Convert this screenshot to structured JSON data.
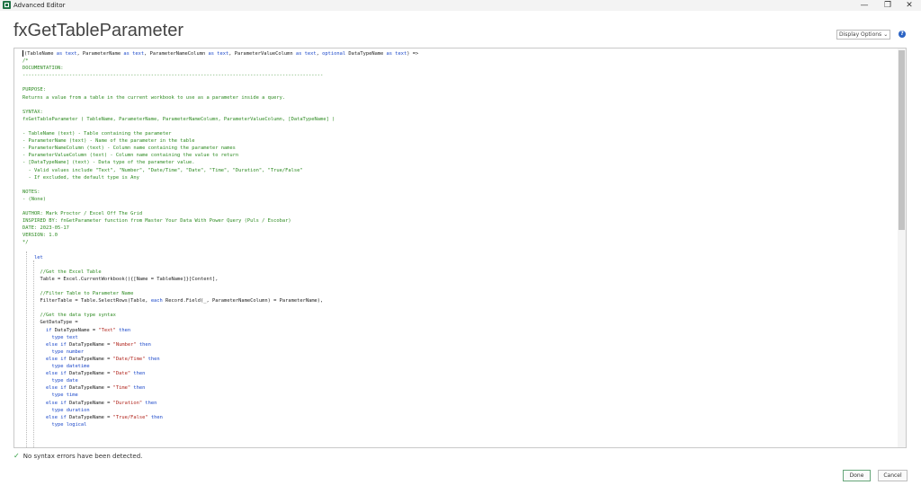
{
  "window": {
    "title": "Advanced Editor",
    "controls": {
      "minimize": "—",
      "maximize": "❐",
      "close": "✕"
    }
  },
  "page_title": "fxGetTableParameter",
  "display_options": {
    "label": "Display Options",
    "chevron": "⌄"
  },
  "help": {
    "glyph": "?"
  },
  "code_lines": [
    [
      {
        "t": "(TableName "
      },
      {
        "t": "as",
        "c": "kw"
      },
      {
        "t": " "
      },
      {
        "t": "text",
        "c": "kw"
      },
      {
        "t": ", ParameterName "
      },
      {
        "t": "as",
        "c": "kw"
      },
      {
        "t": " "
      },
      {
        "t": "text",
        "c": "kw"
      },
      {
        "t": ", ParameterNameColumn "
      },
      {
        "t": "as",
        "c": "kw"
      },
      {
        "t": " "
      },
      {
        "t": "text",
        "c": "kw"
      },
      {
        "t": ", ParameterValueColumn "
      },
      {
        "t": "as",
        "c": "kw"
      },
      {
        "t": " "
      },
      {
        "t": "text",
        "c": "kw"
      },
      {
        "t": ", "
      },
      {
        "t": "optional",
        "c": "kw"
      },
      {
        "t": " DataTypeName "
      },
      {
        "t": "as",
        "c": "kw"
      },
      {
        "t": " "
      },
      {
        "t": "text",
        "c": "kw"
      },
      {
        "t": ") =>"
      }
    ],
    [
      {
        "t": "/*",
        "c": "cm"
      }
    ],
    [
      {
        "t": "DOCUMENTATION:",
        "c": "cm"
      }
    ],
    [
      {
        "t": "-------------------------------------------------------------------------------------------------------",
        "c": "cm"
      }
    ],
    [
      {
        "t": ""
      }
    ],
    [
      {
        "t": "PURPOSE:",
        "c": "cm"
      }
    ],
    [
      {
        "t": "Returns a value from a table in the current workbook to use as a parameter inside a query.",
        "c": "cm"
      }
    ],
    [
      {
        "t": ""
      }
    ],
    [
      {
        "t": "SYNTAX:",
        "c": "cm"
      }
    ],
    [
      {
        "t": "fxGetTableParameter ( TableName, ParameterName, ParameterNameColumn, ParameterValueColumn, [DataTypeName] )",
        "c": "cm"
      }
    ],
    [
      {
        "t": ""
      }
    ],
    [
      {
        "t": "- TableName (text) - Table containing the parameter",
        "c": "cm"
      }
    ],
    [
      {
        "t": "- ParameterName (text) - Name of the parameter in the table",
        "c": "cm"
      }
    ],
    [
      {
        "t": "- ParameterNameColumn (text) - Column name containing the parameter names",
        "c": "cm"
      }
    ],
    [
      {
        "t": "- ParameterValueColumn (text) - Column name containing the value to return",
        "c": "cm"
      }
    ],
    [
      {
        "t": "- [DataTypeName] (text) - Data type of the parameter value.",
        "c": "cm"
      }
    ],
    [
      {
        "t": "  - Valid values include \"Text\", \"Number\", \"Date/Time\", \"Date\", \"Time\", \"Duration\", \"True/False\"",
        "c": "cm"
      }
    ],
    [
      {
        "t": "  - If excluded, the default type is Any",
        "c": "cm"
      }
    ],
    [
      {
        "t": ""
      }
    ],
    [
      {
        "t": "NOTES:",
        "c": "cm"
      }
    ],
    [
      {
        "t": "- (None)",
        "c": "cm"
      }
    ],
    [
      {
        "t": ""
      }
    ],
    [
      {
        "t": "AUTHOR: Mark Proctor / Excel Off The Grid",
        "c": "cm"
      }
    ],
    [
      {
        "t": "INSPIRED BY: fnGetParameter function from Master Your Data With Power Query (Puls / Escobar)",
        "c": "cm"
      }
    ],
    [
      {
        "t": "DATE: 2023-05-17",
        "c": "cm"
      }
    ],
    [
      {
        "t": "VERSION: 1.0",
        "c": "cm"
      }
    ],
    [
      {
        "t": "*/",
        "c": "cm"
      }
    ],
    [
      {
        "t": ""
      }
    ],
    [
      {
        "t": "    "
      },
      {
        "t": "let",
        "c": "kw"
      }
    ],
    [
      {
        "t": ""
      }
    ],
    [
      {
        "t": "      "
      },
      {
        "t": "//Get the Excel Table",
        "c": "cm"
      }
    ],
    [
      {
        "t": "      Table = Excel.CurrentWorkbook(){[Name = TableName]}[Content],"
      }
    ],
    [
      {
        "t": ""
      }
    ],
    [
      {
        "t": "      "
      },
      {
        "t": "//Filter Table to Parameter Name",
        "c": "cm"
      }
    ],
    [
      {
        "t": "      FilterTable = Table.SelectRows(Table, "
      },
      {
        "t": "each",
        "c": "kw"
      },
      {
        "t": " Record.Field(_, ParameterNameColumn) = ParameterName),"
      }
    ],
    [
      {
        "t": ""
      }
    ],
    [
      {
        "t": "      "
      },
      {
        "t": "//Get the data type syntax",
        "c": "cm"
      }
    ],
    [
      {
        "t": "      GetDataType ="
      }
    ],
    [
      {
        "t": "        "
      },
      {
        "t": "if",
        "c": "kw"
      },
      {
        "t": " DataTypeName = "
      },
      {
        "t": "\"Text\"",
        "c": "st"
      },
      {
        "t": " "
      },
      {
        "t": "then",
        "c": "kw"
      }
    ],
    [
      {
        "t": "          "
      },
      {
        "t": "type",
        "c": "kw"
      },
      {
        "t": " "
      },
      {
        "t": "text",
        "c": "kw"
      }
    ],
    [
      {
        "t": "        "
      },
      {
        "t": "else",
        "c": "kw"
      },
      {
        "t": " "
      },
      {
        "t": "if",
        "c": "kw"
      },
      {
        "t": " DataTypeName = "
      },
      {
        "t": "\"Number\"",
        "c": "st"
      },
      {
        "t": " "
      },
      {
        "t": "then",
        "c": "kw"
      }
    ],
    [
      {
        "t": "          "
      },
      {
        "t": "type",
        "c": "kw"
      },
      {
        "t": " "
      },
      {
        "t": "number",
        "c": "kw"
      }
    ],
    [
      {
        "t": "        "
      },
      {
        "t": "else",
        "c": "kw"
      },
      {
        "t": " "
      },
      {
        "t": "if",
        "c": "kw"
      },
      {
        "t": " DataTypeName = "
      },
      {
        "t": "\"Date/Time\"",
        "c": "st"
      },
      {
        "t": " "
      },
      {
        "t": "then",
        "c": "kw"
      }
    ],
    [
      {
        "t": "          "
      },
      {
        "t": "type",
        "c": "kw"
      },
      {
        "t": " "
      },
      {
        "t": "datetime",
        "c": "kw"
      }
    ],
    [
      {
        "t": "        "
      },
      {
        "t": "else",
        "c": "kw"
      },
      {
        "t": " "
      },
      {
        "t": "if",
        "c": "kw"
      },
      {
        "t": " DataTypeName = "
      },
      {
        "t": "\"Date\"",
        "c": "st"
      },
      {
        "t": " "
      },
      {
        "t": "then",
        "c": "kw"
      }
    ],
    [
      {
        "t": "          "
      },
      {
        "t": "type",
        "c": "kw"
      },
      {
        "t": " "
      },
      {
        "t": "date",
        "c": "kw"
      }
    ],
    [
      {
        "t": "        "
      },
      {
        "t": "else",
        "c": "kw"
      },
      {
        "t": " "
      },
      {
        "t": "if",
        "c": "kw"
      },
      {
        "t": " DataTypeName = "
      },
      {
        "t": "\"Time\"",
        "c": "st"
      },
      {
        "t": " "
      },
      {
        "t": "then",
        "c": "kw"
      }
    ],
    [
      {
        "t": "          "
      },
      {
        "t": "type",
        "c": "kw"
      },
      {
        "t": " "
      },
      {
        "t": "time",
        "c": "kw"
      }
    ],
    [
      {
        "t": "        "
      },
      {
        "t": "else",
        "c": "kw"
      },
      {
        "t": " "
      },
      {
        "t": "if",
        "c": "kw"
      },
      {
        "t": " DataTypeName = "
      },
      {
        "t": "\"Duration\"",
        "c": "st"
      },
      {
        "t": " "
      },
      {
        "t": "then",
        "c": "kw"
      }
    ],
    [
      {
        "t": "          "
      },
      {
        "t": "type",
        "c": "kw"
      },
      {
        "t": " "
      },
      {
        "t": "duration",
        "c": "kw"
      }
    ],
    [
      {
        "t": "        "
      },
      {
        "t": "else",
        "c": "kw"
      },
      {
        "t": " "
      },
      {
        "t": "if",
        "c": "kw"
      },
      {
        "t": " DataTypeName = "
      },
      {
        "t": "\"True/False\"",
        "c": "st"
      },
      {
        "t": " "
      },
      {
        "t": "then",
        "c": "kw"
      }
    ],
    [
      {
        "t": "          "
      },
      {
        "t": "type",
        "c": "kw"
      },
      {
        "t": " "
      },
      {
        "t": "logical",
        "c": "kw"
      }
    ]
  ],
  "status": {
    "icon": "✓",
    "text": "No syntax errors have been detected."
  },
  "buttons": {
    "done": "Done",
    "cancel": "Cancel"
  },
  "colors": {
    "keyword": "#1a47c9",
    "comment": "#2e8b22",
    "string": "#b0241c",
    "excel_green": "#217346",
    "help_blue": "#2b63c4",
    "check_green": "#2e9d3f"
  }
}
